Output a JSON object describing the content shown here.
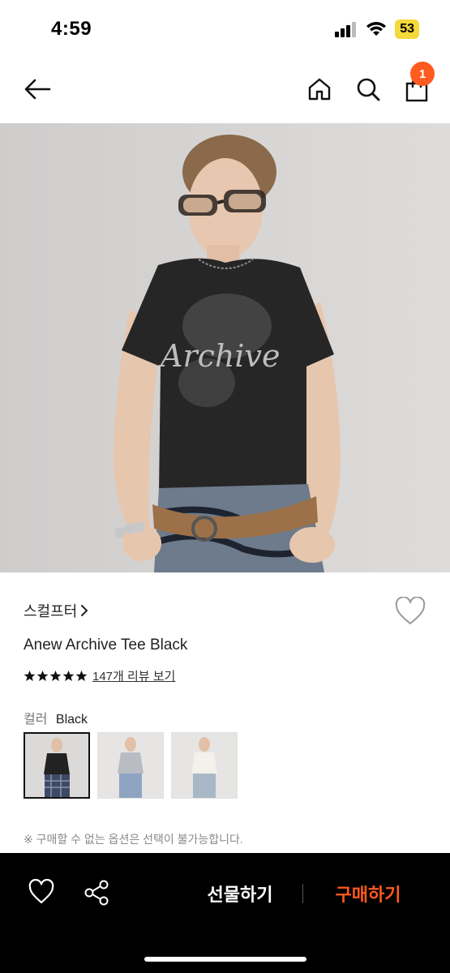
{
  "status_bar": {
    "time": "4:59",
    "battery": "53"
  },
  "nav": {
    "cart_badge": "1"
  },
  "product": {
    "brand": "스컬프터",
    "title": "Anew Archive Tee Black",
    "rating_stars": 5,
    "review_link": "147개 리뷰 보기",
    "color_label": "컬러",
    "color_value": "Black",
    "shirt_print": "Archive",
    "notice": "※ 구매할 수 없는 옵션은 선택이 불가능합니다."
  },
  "bottom_bar": {
    "gift_label": "선물하기",
    "buy_label": "구매하기"
  },
  "colors": {
    "accent": "#ff5a1f",
    "bottom_bar_bg": "#000000",
    "battery": "#f5d83a"
  }
}
